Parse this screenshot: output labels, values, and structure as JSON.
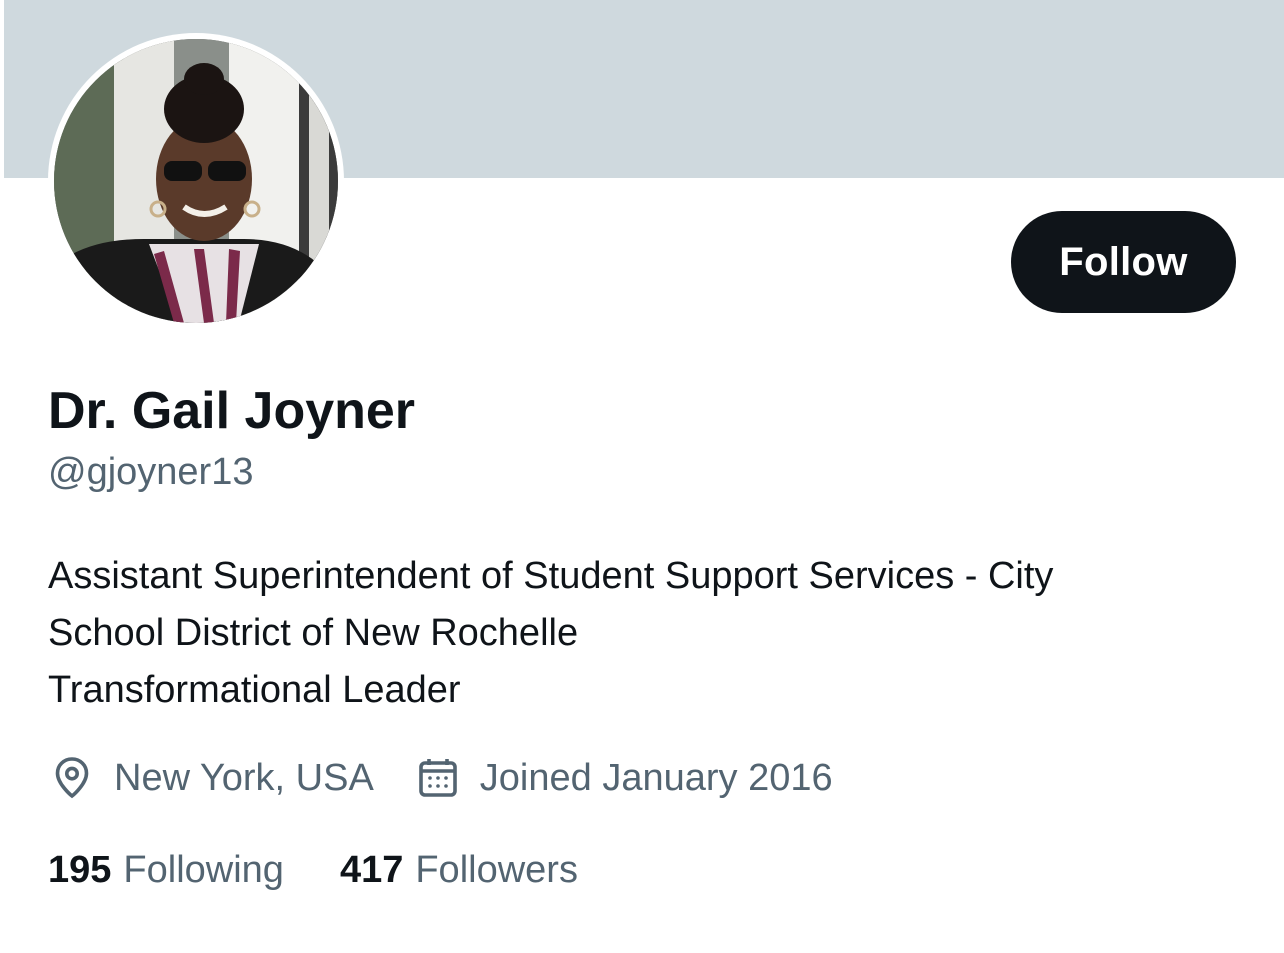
{
  "profile": {
    "display_name": "Dr. Gail Joyner",
    "handle": "@gjoyner13",
    "follow_label": "Follow",
    "bio_lines": [
      "Assistant Superintendent of Student Support Services - City",
      "School District of New Rochelle",
      "Transformational Leader"
    ],
    "location": "New York, USA",
    "joined": "Joined January 2016",
    "following_count": "195",
    "following_label": "Following",
    "followers_count": "417",
    "followers_label": "Followers"
  },
  "icons": {
    "location": "location-pin-icon",
    "joined": "calendar-icon"
  },
  "colors": {
    "banner": "#cfd9de",
    "button_bg": "#0f1419",
    "primary_text": "#0f1419",
    "secondary_text": "#536471"
  }
}
